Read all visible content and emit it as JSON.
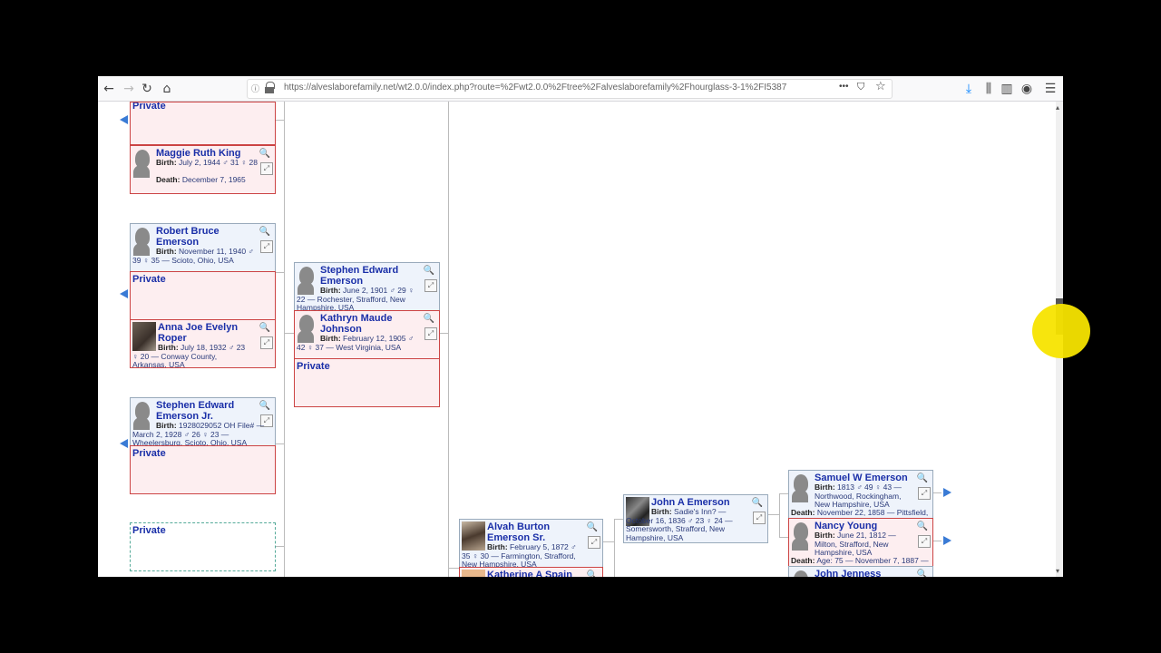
{
  "browser": {
    "url": "https://alveslaborefamily.net/wt2.0.0/index.php?route=%2Fwt2.0.0%2Ftree%2Falveslaborefamily%2Fhourglass-3-1%2FI5387",
    "nav": {
      "back": "←",
      "forward": "→",
      "reload": "↻",
      "home": "⌂"
    },
    "icons": {
      "lock": "lock-icon",
      "more": "•••",
      "pocket": "⛉",
      "star": "☆",
      "download": "⤓",
      "library": "⫼",
      "sidebar": "▥",
      "account": "◉",
      "menu": "☰"
    }
  },
  "tree": {
    "private": "Private",
    "left": [
      {
        "name": "Maggie Ruth King",
        "birth_label": "Birth:",
        "birth": "July 2, 1944 ♂ 31 ♀ 28",
        "death_label": "Death:",
        "death": "December 7, 1965"
      },
      {
        "name": "Robert Bruce Emerson",
        "birth_label": "Birth:",
        "birth": "November 11, 1940 ♂ 39 ♀ 35 — Scioto, Ohio, USA"
      },
      {
        "name": "Anna Joe Evelyn Roper",
        "birth_label": "Birth:",
        "birth": "July 18, 1932 ♂ 23 ♀ 20 — Conway County, Arkansas, USA"
      },
      {
        "name": "Stephen Edward Emerson Jr.",
        "birth_label": "Birth:",
        "birth": "1928029052 OH File# — March 2, 1928 ♂ 26 ♀ 23 — Wheelersburg, Scioto, Ohio, USA"
      }
    ],
    "middle": [
      {
        "name": "Stephen Edward Emerson",
        "birth_label": "Birth:",
        "birth": "June 2, 1901 ♂ 29 ♀ 22 — Rochester, Strafford, New Hampshire, USA"
      },
      {
        "name": "Kathryn Maude Johnson",
        "birth_label": "Birth:",
        "birth": "February 12, 1905 ♂ 42 ♀ 37 — West Virginia, USA"
      }
    ],
    "right": [
      {
        "name": "Alvah Burton Emerson Sr.",
        "birth_label": "Birth:",
        "birth": "February 5, 1872 ♂ 35 ♀ 30 — Farmington, Strafford, New Hampshire, USA"
      },
      {
        "name": "Katherine A Spain"
      },
      {
        "name": "John A Emerson",
        "birth_label": "Birth:",
        "birth": "Sadie's Inn? — October 16, 1836 ♂ 23 ♀ 24 — Somersworth, Strafford, New Hampshire, USA"
      },
      {
        "name": "Samuel W Emerson",
        "birth_label": "Birth:",
        "birth": "1813 ♂ 49 ♀ 43 — Northwood, Rockingham, New Hampshire, USA",
        "death_label": "Death:",
        "death": "November 22, 1858 — Pittsfield,"
      },
      {
        "name": "Nancy Young",
        "birth_label": "Birth:",
        "birth": "June 21, 1812 — Milton, Strafford, New Hampshire, USA",
        "death_label": "Death:",
        "death": "Age: 75 — November 7, 1887 —"
      },
      {
        "name": "John Jenness"
      }
    ]
  }
}
